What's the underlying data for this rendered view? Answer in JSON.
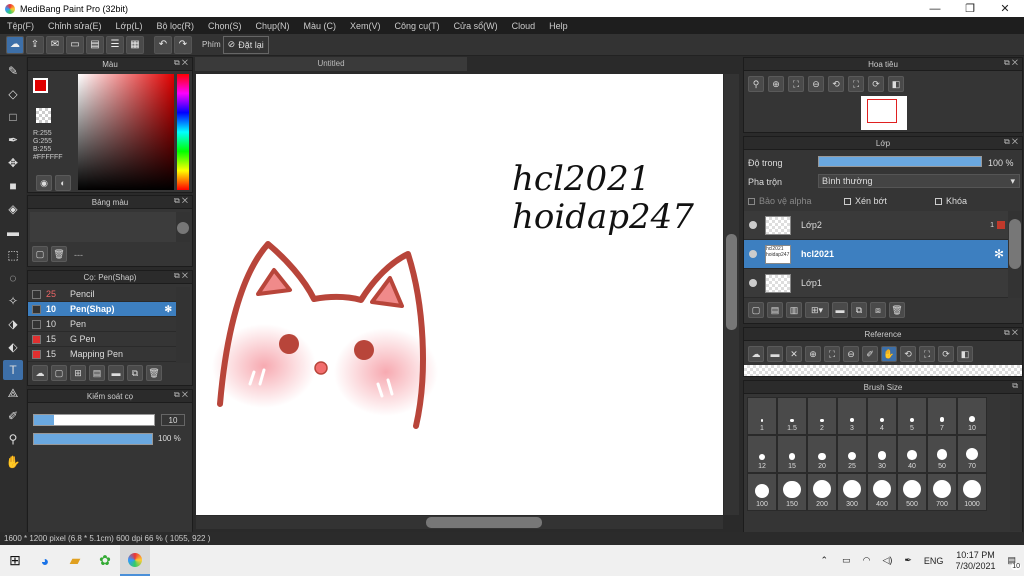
{
  "titlebar": {
    "title": "MediBang Paint Pro (32bit)"
  },
  "menu": [
    "Tệp(F)",
    "Chỉnh sửa(E)",
    "Lớp(L)",
    "Bộ lọc(R)",
    "Chọn(S)",
    "Chụp(N)",
    "Màu (C)",
    "Xem(V)",
    "Công cụ(T)",
    "Cửa sổ(W)",
    "Cloud",
    "Help"
  ],
  "toolbar": {
    "key_label": "Phím",
    "reset_label": "Đặt lại"
  },
  "color_panel": {
    "title": "Màu",
    "r": "R:255",
    "g": "G:255",
    "b": "B:255",
    "hex": "#FFFFFF",
    "fg": "#e00000",
    "bg": "#ffffff"
  },
  "palette_panel": {
    "title": "Bảng màu",
    "dash": "---"
  },
  "brush_panel": {
    "title": "Cọ: Pen(Shap)",
    "items": [
      {
        "size": "25",
        "name": "Pencil",
        "color": "#333333"
      },
      {
        "size": "10",
        "name": "Pen(Shap)",
        "color": "#333333"
      },
      {
        "size": "10",
        "name": "Pen",
        "color": "#333333"
      },
      {
        "size": "15",
        "name": "G Pen",
        "color": "#e03030"
      },
      {
        "size": "15",
        "name": "Mapping Pen",
        "color": "#e03030"
      }
    ]
  },
  "brush_control": {
    "title": "Kiểm soát cọ",
    "size": "10",
    "opacity": "100 %",
    "size_frac": 0.17,
    "opacity_frac": 1.0
  },
  "document": {
    "tab": "Untitled",
    "text_line1": "hcl2021",
    "text_line2": "hoidap247"
  },
  "navigator": {
    "title": "Hoa tiêu"
  },
  "layer_panel": {
    "title": "Lớp",
    "opacity_label": "Độ trong",
    "opacity_value": "100 %",
    "blend_label": "Pha trộn",
    "blend_value": "Bình thường",
    "protect_alpha": "Bảo vệ alpha",
    "clipping": "Xén bớt",
    "lock": "Khóa",
    "layers": [
      {
        "name": "Lớp2",
        "selected": false,
        "thumb": "",
        "badge": "1"
      },
      {
        "name": "hcl2021",
        "selected": true,
        "thumb": "hcl2021 hoidap247",
        "badge": ""
      },
      {
        "name": "Lớp1",
        "selected": false,
        "thumb": "",
        "badge": ""
      }
    ]
  },
  "reference_panel": {
    "title": "Reference"
  },
  "brushsize_panel": {
    "title": "Brush Size",
    "sizes": [
      "1",
      "1.5",
      "2",
      "3",
      "4",
      "5",
      "7",
      "10",
      "12",
      "15",
      "20",
      "25",
      "30",
      "40",
      "50",
      "70",
      "100",
      "150",
      "200",
      "300",
      "400",
      "500",
      "700",
      "1000"
    ]
  },
  "statusbar": {
    "text": "1600 * 1200 pixel   (6.8 * 5.1cm)   600 dpi   66 %   ( 1055, 922 )"
  },
  "taskbar": {
    "lang": "ENG",
    "time": "10:17 PM",
    "date": "7/30/2021",
    "notif": "10"
  }
}
